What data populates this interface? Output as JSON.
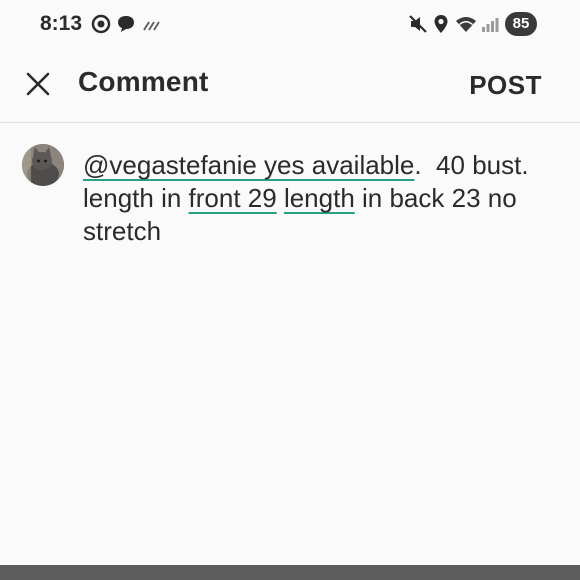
{
  "status_bar": {
    "time": "8:13",
    "battery": "85",
    "icons": [
      "record-icon",
      "chat-bubble-icon",
      "signal-stripes-icon",
      "mute-icon",
      "location-icon",
      "wifi-icon",
      "cell-signal-icon"
    ]
  },
  "header": {
    "title": "Comment",
    "post_label": "POST",
    "close_icon": "close-icon"
  },
  "comment": {
    "segments": [
      {
        "text": "@vegastefanie yes available",
        "underlined": true
      },
      {
        "text": ".  40 bust. length in ",
        "underlined": false
      },
      {
        "text": "front 29",
        "underlined": true
      },
      {
        "text": " ",
        "underlined": false
      },
      {
        "text": "length",
        "underlined": true
      },
      {
        "text": " in back 23 no stretch",
        "underlined": false
      }
    ]
  },
  "colors": {
    "underline": "#2aa083",
    "text": "#2b2b2b",
    "background": "#fafafa",
    "bottom_bar": "#5d5d5d"
  }
}
